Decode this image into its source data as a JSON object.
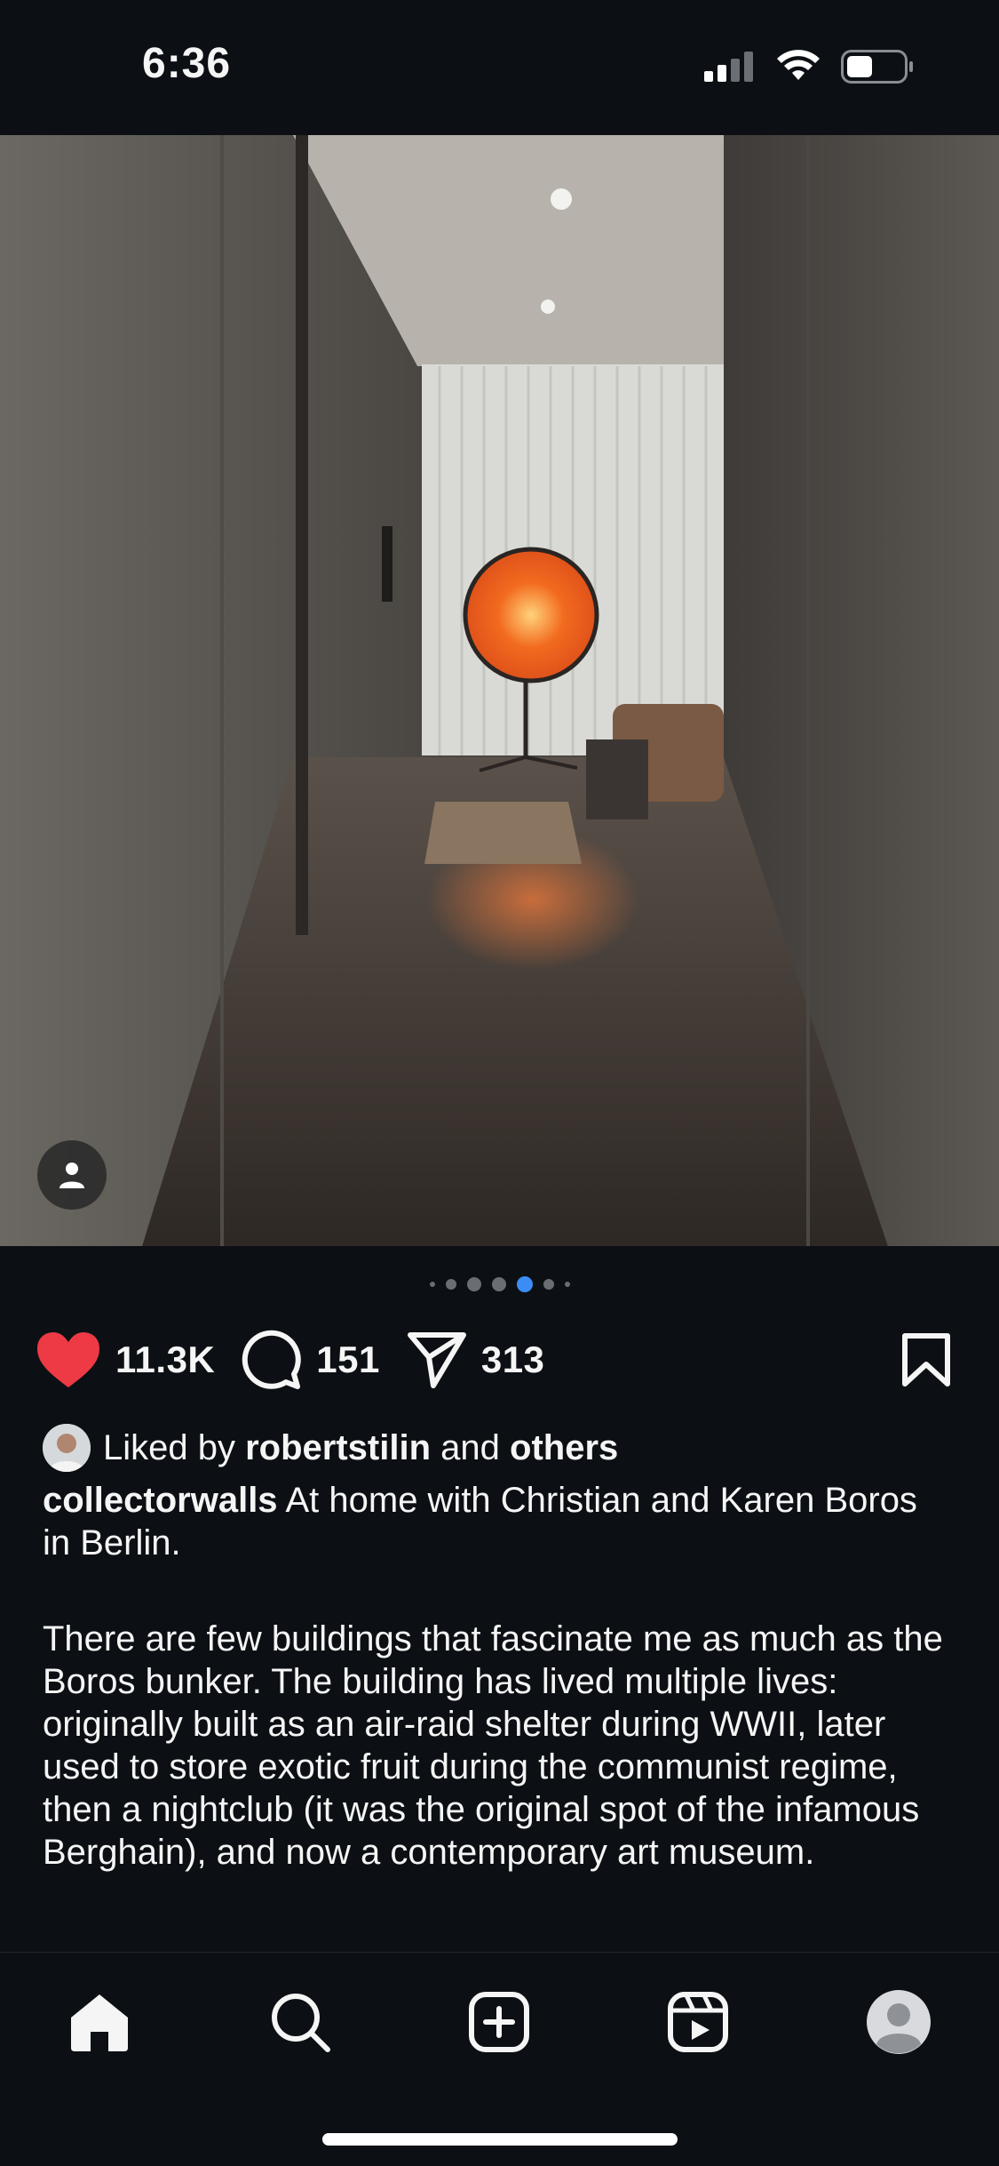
{
  "status_bar": {
    "time": "6:36",
    "signal_icon": "cellular-signal-icon",
    "wifi_icon": "wifi-icon",
    "battery_icon": "battery-low-icon"
  },
  "post": {
    "carousel": {
      "total": 7,
      "active_index": 4
    },
    "likes_count": "11.3K",
    "comments_count": "151",
    "shares_count": "313",
    "liked_by_prefix": "Liked by",
    "liked_by_user": "robertstilin",
    "liked_by_and": "and",
    "liked_by_others": "others",
    "username": "collectorwalls",
    "caption_first": " At home with Christian and Karen Boros in Berlin.",
    "caption_body": "There are few buildings that fascinate me as much as the Boros bunker. The building has lived multiple lives: originally built as an air-raid shelter during WWII, later used to store exotic fruit during the communist regime, then a nightclub (it was the original spot of the infamous Berghain), and now a contemporary art museum.",
    "colors": {
      "heart": "#ed3a45",
      "active_dot": "#3b8cf5",
      "background": "#0c1014"
    }
  },
  "nav": {
    "items": [
      {
        "id": "home",
        "icon": "home-icon"
      },
      {
        "id": "search",
        "icon": "search-icon"
      },
      {
        "id": "create",
        "icon": "add-post-icon"
      },
      {
        "id": "reels",
        "icon": "reels-icon"
      },
      {
        "id": "profile",
        "icon": "profile-avatar-icon"
      }
    ]
  }
}
